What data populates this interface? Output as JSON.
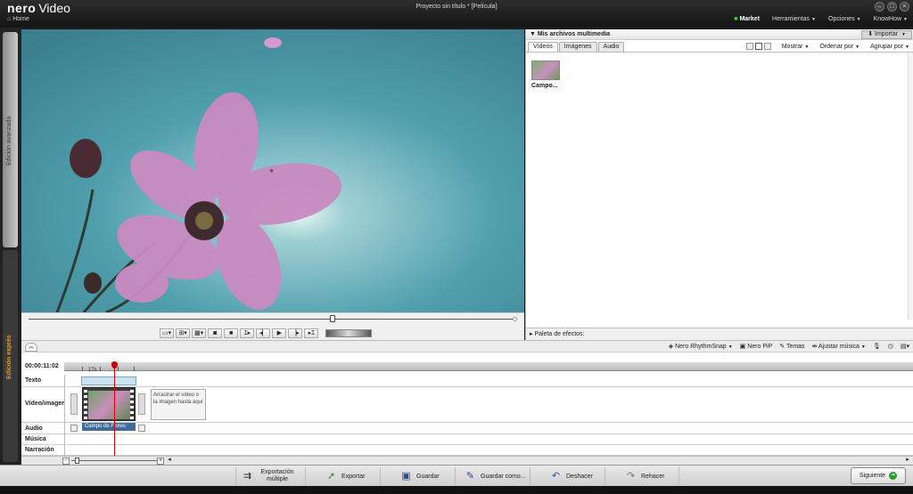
{
  "app": {
    "brand_bold": "nero",
    "brand_name": "Video",
    "window_title": "Proyecto sin título * [Película]",
    "home": "Home"
  },
  "menu": {
    "market": "Market",
    "herramientas": "Herramientas",
    "opciones": "Opciones",
    "knowhow": "KnowHow"
  },
  "side_tabs": {
    "advanced": "Edición avanzada",
    "express": "Edición exprés"
  },
  "media": {
    "title": "Mis archivos multimedia",
    "import": "Importar",
    "tabs": [
      "Vídeos",
      "Imágenes",
      "Audio"
    ],
    "mostrar": "Mostrar",
    "ordenar": "Ordenar por",
    "agrupar": "Agrupar por",
    "clip_label": "Campo...",
    "effects_palette": "Paleta de efectos:"
  },
  "timeline": {
    "timecode": "00:00:11:02",
    "tick_label": "17s",
    "tracks": [
      "Texto",
      "Vídeo/imagen",
      "Audio",
      "Música",
      "Narración"
    ],
    "drop_hint": "Arrastrar el vídeo o la imagen hasta aquí",
    "clip_name": "Campo de Flores",
    "tools": {
      "rhythmsnap": "Nero RhythmSnap",
      "pip": "Nero PiP",
      "temas": "Temas",
      "ajustar": "Ajustar música"
    }
  },
  "bottom": {
    "export_multiple": "Exportación múltiple",
    "exportar": "Exportar",
    "guardar": "Guardar",
    "guardar_como": "Guardar como...",
    "deshacer": "Deshacer",
    "rehacer": "Rehacer",
    "siguiente": "Siguiente"
  },
  "colors": {
    "preview_sky": "#4a9aa8",
    "accent_orange": "#e08a1e",
    "playhead": "#dd0000",
    "clip_label_bg": "#3f6c99"
  }
}
